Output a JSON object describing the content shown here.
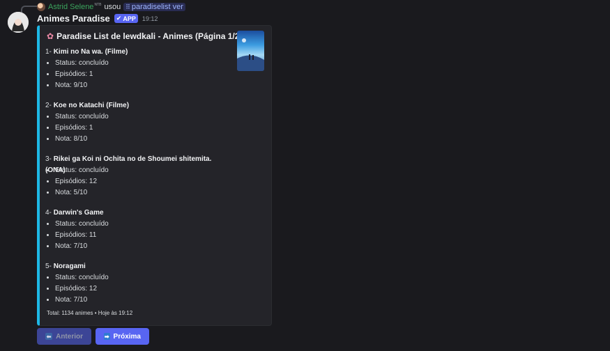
{
  "reply": {
    "user": "Astrid Selene",
    "user_tag": "NTB",
    "verb": "usou",
    "command": "paradiselist ver"
  },
  "message": {
    "bot_name": "Animes Paradise",
    "badge": "APP",
    "timestamp": "19:12"
  },
  "embed": {
    "accent_color": "#1db8e6",
    "title": "Paradise List de lewdkali - Animes (Página 1/227)",
    "items": [
      {
        "prefix": "1-",
        "name": "Kimi no Na wa. (Filme)",
        "status": "Status: concluído",
        "episodes": "Episódios: 1",
        "score": "Nota: 9/10"
      },
      {
        "prefix": "2-",
        "name": "Koe no Katachi (Filme)",
        "status": "Status: concluído",
        "episodes": "Episódios: 1",
        "score": "Nota: 8/10"
      },
      {
        "prefix": "3-",
        "name": "Rikei ga Koi ni Ochita no de Shoumei shitemita. (ONA)",
        "status": "Status: concluído",
        "episodes": "Episódios: 12",
        "score": "Nota: 5/10"
      },
      {
        "prefix": "4-",
        "name": "Darwin's Game",
        "status": "Status: concluído",
        "episodes": "Episódios: 11",
        "score": "Nota: 7/10"
      },
      {
        "prefix": "5-",
        "name": "Noragami",
        "status": "Status: concluído",
        "episodes": "Episódios: 12",
        "score": "Nota: 7/10"
      }
    ],
    "footer": "Total: 1134 animes • Hoje às 19:12"
  },
  "buttons": {
    "prev_label": "Anterior",
    "next_label": "Próxima"
  }
}
